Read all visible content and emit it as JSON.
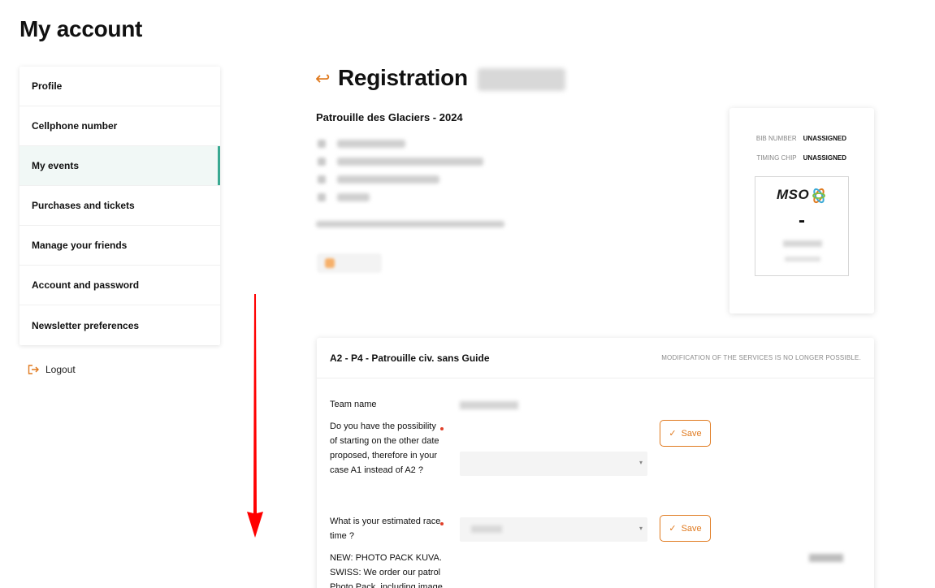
{
  "page": {
    "title": "My account"
  },
  "sidebar": {
    "items": [
      {
        "label": "Profile"
      },
      {
        "label": "Cellphone number"
      },
      {
        "label": "My events"
      },
      {
        "label": "Purchases and tickets"
      },
      {
        "label": "Manage your friends"
      },
      {
        "label": "Account and password"
      },
      {
        "label": "Newsletter preferences"
      }
    ],
    "active_index": 2
  },
  "logout": {
    "label": "Logout"
  },
  "registration": {
    "title": "Registration",
    "event_name": "Patrouille des Glaciers - 2024"
  },
  "bib_card": {
    "bib_label": "BIB NUMBER",
    "bib_value": "UNASSIGNED",
    "chip_label": "TIMING CHIP",
    "chip_value": "UNASSIGNED",
    "logo_text": "MSO",
    "bib_display": "-"
  },
  "services": {
    "title": "A2 - P4 - Patrouille civ. sans Guide",
    "note": "MODIFICATION OF THE SERVICES IS NO LONGER POSSIBLE.",
    "team_label": "Team name",
    "q1_label": "Do you have the possibility of starting on the other date proposed, therefore in your case A1 instead of A2 ?",
    "q2_label": "What is your estimated race time ?",
    "q3_label": "NEW: PHOTO PACK KUVA.SWISS: We order our patrol Photo Pack, including image",
    "save_label": "Save"
  },
  "colors": {
    "accent": "#e07a1f",
    "active": "#3aa992",
    "required": "#e0402a",
    "annotation": "#ff0000"
  }
}
